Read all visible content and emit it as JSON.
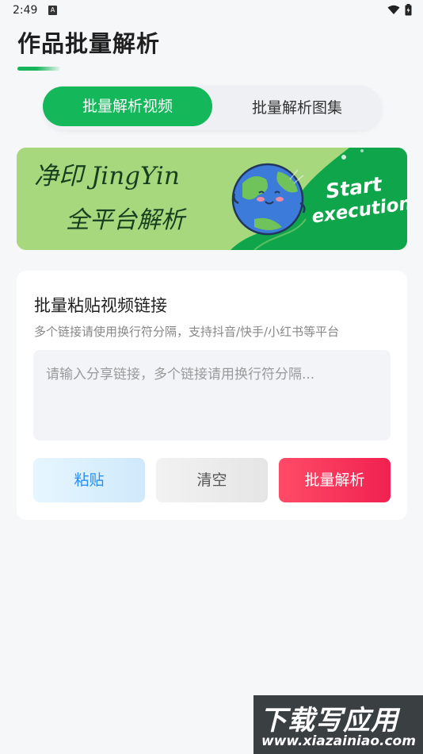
{
  "status_bar": {
    "time": "2:49",
    "notification_icon_letter": "A",
    "wifi_icon": "wifi-icon",
    "battery_icon": "battery-icon"
  },
  "header": {
    "title": "作品批量解析"
  },
  "tabs": [
    {
      "label": "批量解析视频",
      "active": true
    },
    {
      "label": "批量解析图集",
      "active": false
    }
  ],
  "banner": {
    "line1": "净印 JingYin",
    "line2": "全平台解析",
    "start": "Start",
    "execution": "execution"
  },
  "input_card": {
    "title": "批量粘贴视频链接",
    "subtitle": "多个链接请使用换行符分隔，支持抖音/快手/小红书等平台",
    "placeholder": "请输入分享链接，多个链接请用换行符分隔...",
    "value": ""
  },
  "buttons": {
    "paste": "粘贴",
    "clear": "清空",
    "parse": "批量解析"
  },
  "watermark": {
    "line1": "下载写应用",
    "line2": "www.xiazainiao.com"
  },
  "colors": {
    "accent_green": "#14b85a",
    "parse_red": "#f02150",
    "paste_blue": "#2b8ff0",
    "background": "#f6f7f9"
  }
}
